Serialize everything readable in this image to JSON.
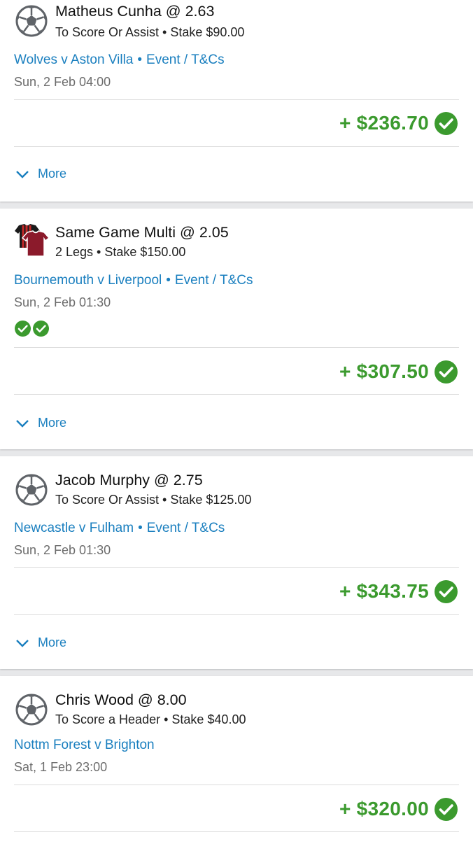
{
  "theme": {
    "link": "#1a7fbf",
    "win_green": "#3b9a2e",
    "meta_grey": "#6d6d6d"
  },
  "bets": [
    {
      "icon": "soccer-ball-icon",
      "title": "Matheus Cunha @ 2.63",
      "subtitle": "To Score Or Assist • Stake $90.00",
      "event": "Wolves v Aston Villa",
      "event_link": "Event / T&Cs",
      "datetime": "Sun, 2 Feb 04:00",
      "payout": "+ $236.70",
      "status_icon": "check-circle-icon",
      "more_label": "More"
    },
    {
      "icon": "jerseys-icon",
      "title": "Same Game Multi @ 2.05",
      "subtitle": "2 Legs • Stake $150.00",
      "event": "Bournemouth v Liverpool",
      "event_link": "Event / T&Cs",
      "datetime": "Sun, 2 Feb 01:30",
      "legs_status": [
        "won",
        "won"
      ],
      "payout": "+ $307.50",
      "status_icon": "check-circle-icon",
      "more_label": "More"
    },
    {
      "icon": "soccer-ball-icon",
      "title": "Jacob Murphy @ 2.75",
      "subtitle": "To Score Or Assist • Stake $125.00",
      "event": "Newcastle v Fulham",
      "event_link": "Event / T&Cs",
      "datetime": "Sun, 2 Feb 01:30",
      "payout": "+ $343.75",
      "status_icon": "check-circle-icon",
      "more_label": "More"
    },
    {
      "icon": "soccer-ball-icon",
      "title": "Chris Wood @ 8.00",
      "subtitle": "To Score a Header • Stake $40.00",
      "event": "Nottm Forest v Brighton",
      "datetime": "Sat, 1 Feb 23:00",
      "payout": "+ $320.00",
      "status_icon": "check-circle-icon"
    }
  ]
}
